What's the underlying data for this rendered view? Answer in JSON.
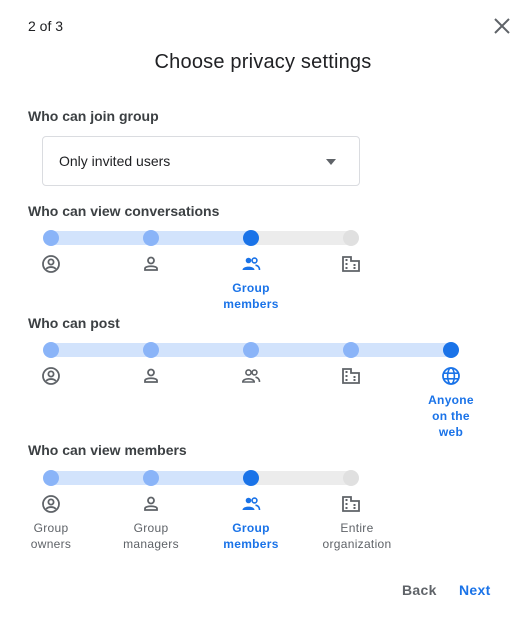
{
  "header": {
    "step": "2 of 3",
    "title": "Choose privacy settings"
  },
  "join": {
    "label": "Who can join group",
    "value": "Only invited users"
  },
  "view_conversations": {
    "label": "Who can view conversations",
    "selected_label": "Group members"
  },
  "post": {
    "label": "Who can post",
    "selected_label": "Anyone on the web"
  },
  "view_members": {
    "label": "Who can view members",
    "options": [
      "Group owners",
      "Group managers",
      "Group members",
      "Entire organization"
    ]
  },
  "icons": [
    "account-circle-icon",
    "person-icon",
    "people-icon",
    "building-icon",
    "globe-icon"
  ],
  "footer": {
    "back": "Back",
    "next": "Next"
  },
  "colors": {
    "accent": "#1a73e8",
    "accent_light": "#8ab4f8",
    "track_fill": "#d2e3fc",
    "track_empty": "#ececec"
  }
}
